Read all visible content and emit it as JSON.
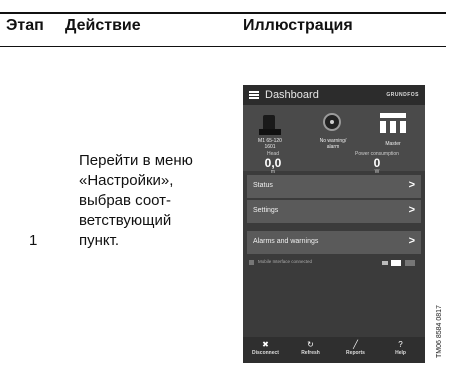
{
  "table": {
    "headers": [
      "Этап",
      "Действие",
      "Иллюстрация"
    ],
    "row": {
      "step": "1",
      "action_lines": [
        "Перейти в меню",
        "«Настройки»,",
        "выбрав соот-",
        "ветствующий",
        "пункт."
      ]
    }
  },
  "phone": {
    "title": "Dashboard",
    "brand": "GRUNDFOS",
    "pump_label": [
      "M1 65-120",
      "1601"
    ],
    "warning_label": [
      "No warning/",
      "alarm"
    ],
    "master_label": "Master",
    "head": {
      "label": "Head",
      "value": "0,0",
      "unit": "m"
    },
    "power": {
      "label": "Power consumption",
      "value": "0",
      "unit": "W"
    },
    "menu_items": [
      {
        "label": "Status",
        "chevron": ">"
      },
      {
        "label": "Settings",
        "chevron": ">"
      },
      {
        "label": "Alarms and warnings",
        "chevron": ">"
      }
    ],
    "connection_text": "Mobile Interface connected",
    "footer": [
      {
        "label": "Disconnect",
        "icon": "✖"
      },
      {
        "label": "Refresh",
        "icon": "↻"
      },
      {
        "label": "Reports",
        "icon": "╱"
      },
      {
        "label": "Help",
        "icon": "?"
      }
    ]
  },
  "figure_code": "TM06 8584 0817",
  "icons": {
    "menu": "menu-icon",
    "pump": "pump-icon",
    "warning": "warning-status-icon",
    "master": "master-icon",
    "disconnect": "disconnect-icon",
    "refresh": "refresh-icon",
    "reports": "reports-icon",
    "help": "help-icon"
  },
  "colors": {
    "phone_bg": "#3b3b3b",
    "status_panel": "#4a4a4a",
    "menu_item": "#5a5a5a",
    "footer": "#2f2f2f"
  }
}
